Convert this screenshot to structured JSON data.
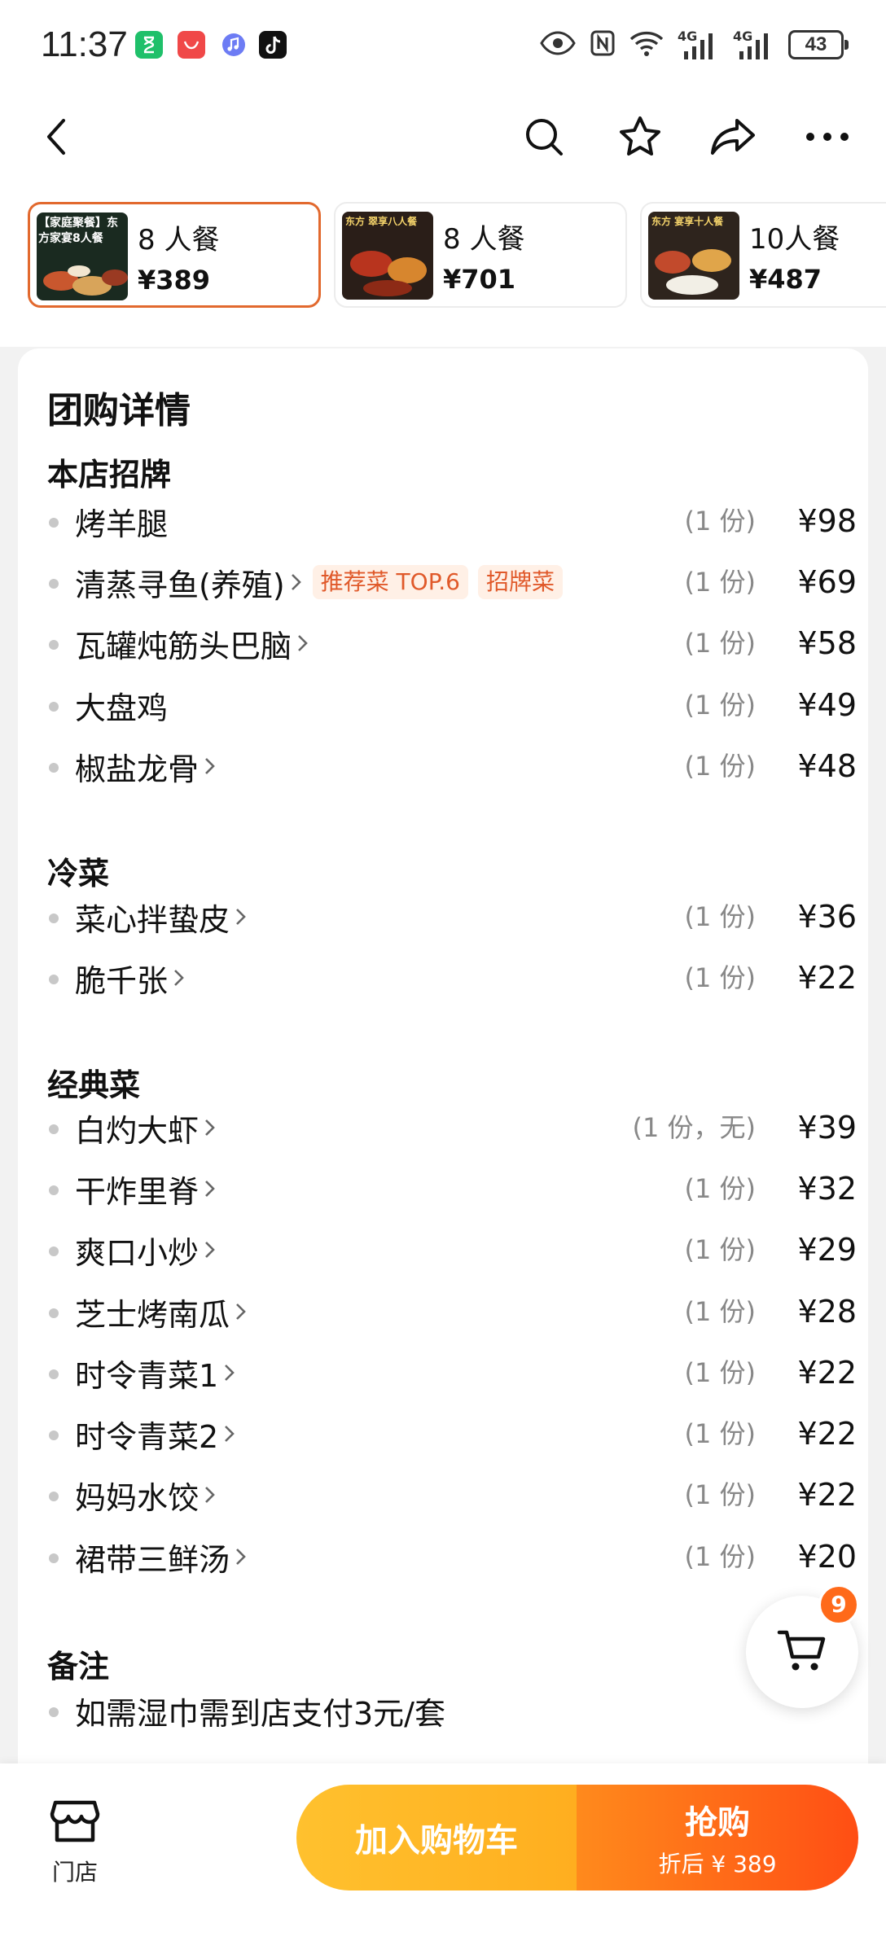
{
  "status_bar": {
    "time": "11:37",
    "network_1": "4G",
    "network_2": "4G",
    "battery": "43",
    "app_icons": [
      "hourglass-app-icon",
      "huawei-app-icon",
      "music-app-icon",
      "tiktok-app-icon"
    ]
  },
  "nav": {
    "back_icon": "back-arrow-icon",
    "search_icon": "search-icon",
    "favorite_icon": "star-icon",
    "share_icon": "share-icon",
    "more_icon": "more-icon"
  },
  "packages": [
    {
      "name": "8 人餐",
      "price": "¥389",
      "thumb_text": "【家庭聚餐】东方家宴8人餐",
      "selected": true
    },
    {
      "name": "8 人餐",
      "price": "¥701",
      "thumb_text": "东方 翠享八人餐",
      "selected": false
    },
    {
      "name": "10人餐",
      "price": "¥487",
      "thumb_text": "东方 宴享十人餐",
      "selected": false
    }
  ],
  "detail": {
    "title": "团购详情",
    "sections": [
      {
        "title": "本店招牌",
        "items": [
          {
            "name": "烤羊腿",
            "chevron": false,
            "tags": [],
            "qty": "(1 份)",
            "price": "¥98"
          },
          {
            "name": "清蒸寻鱼(养殖)",
            "chevron": true,
            "tags": [
              "推荐菜 TOP.6",
              "招牌菜"
            ],
            "qty": "(1 份)",
            "price": "¥69"
          },
          {
            "name": "瓦罐炖筋头巴脑",
            "chevron": true,
            "tags": [],
            "qty": "(1 份)",
            "price": "¥58"
          },
          {
            "name": "大盘鸡",
            "chevron": false,
            "tags": [],
            "qty": "(1 份)",
            "price": "¥49"
          },
          {
            "name": "椒盐龙骨",
            "chevron": true,
            "tags": [],
            "qty": "(1 份)",
            "price": "¥48"
          }
        ]
      },
      {
        "title": "冷菜",
        "items": [
          {
            "name": "菜心拌蛰皮",
            "chevron": true,
            "tags": [],
            "qty": "(1 份)",
            "price": "¥36"
          },
          {
            "name": "脆千张",
            "chevron": true,
            "tags": [],
            "qty": "(1 份)",
            "price": "¥22"
          }
        ]
      },
      {
        "title": "经典菜",
        "items": [
          {
            "name": "白灼大虾",
            "chevron": true,
            "tags": [],
            "qty": "(1 份，无)",
            "price": "¥39"
          },
          {
            "name": "干炸里脊",
            "chevron": true,
            "tags": [],
            "qty": "(1 份)",
            "price": "¥32"
          },
          {
            "name": "爽口小炒",
            "chevron": true,
            "tags": [],
            "qty": "(1 份)",
            "price": "¥29"
          },
          {
            "name": "芝士烤南瓜",
            "chevron": true,
            "tags": [],
            "qty": "(1 份)",
            "price": "¥28"
          },
          {
            "name": "时令青菜1",
            "chevron": true,
            "tags": [],
            "qty": "(1 份)",
            "price": "¥22"
          },
          {
            "name": "时令青菜2",
            "chevron": true,
            "tags": [],
            "qty": "(1 份)",
            "price": "¥22"
          },
          {
            "name": "妈妈水饺",
            "chevron": true,
            "tags": [],
            "qty": "(1 份)",
            "price": "¥22"
          },
          {
            "name": "裙带三鲜汤",
            "chevron": true,
            "tags": [],
            "qty": "(1 份)",
            "price": "¥20"
          }
        ]
      }
    ],
    "notes": {
      "title": "备注",
      "items": [
        "如需湿巾需到店支付3元/套"
      ]
    }
  },
  "cart": {
    "icon": "cart-icon",
    "badge": "9"
  },
  "bottom_bar": {
    "store_icon": "store-icon",
    "store_label": "门店",
    "add_to_cart": "加入购物车",
    "buy_now": "抢购",
    "buy_sub": "折后 ¥ 389"
  },
  "colors": {
    "accent_orange": "#e2692e",
    "tag_text": "#e0592a",
    "tag_bg": "#fff0e6",
    "add_cart_yellow": "#ffb81f",
    "buy_orange": "#ff5a14"
  }
}
